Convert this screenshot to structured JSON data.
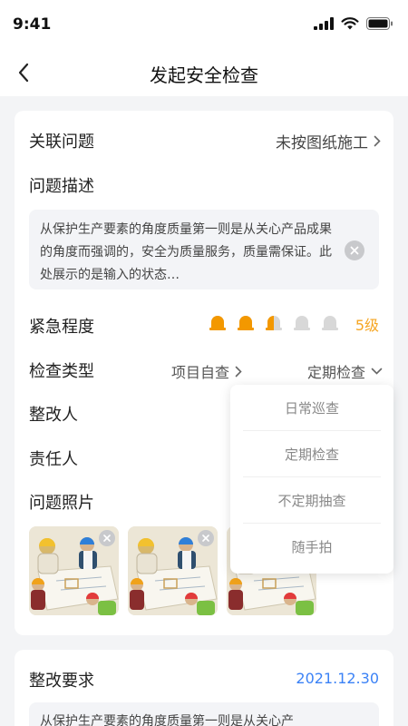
{
  "status": {
    "time": "9:41"
  },
  "nav": {
    "title": "发起安全检查"
  },
  "form": {
    "related_issue": {
      "label": "关联问题",
      "value": "未按图纸施工"
    },
    "issue_desc": {
      "label": "问题描述",
      "text": "从保护生产要素的角度质量第一则是从关心产品成果的角度而强调的，安全为质量服务，质量需保证。此处展示的是输入的状态…"
    },
    "urgency": {
      "label": "紧急程度",
      "level_text": "5级",
      "level": 2.5,
      "max": 5,
      "active_color": "#f39800",
      "inactive_color": "#d8d8d8"
    },
    "check_type": {
      "label": "检查类型",
      "category_value": "项目自查",
      "period_value": "定期检查"
    },
    "rectifier": {
      "label": "整改人"
    },
    "responsible": {
      "label": "责任人"
    },
    "photos": {
      "label": "问题照片",
      "count": 3
    }
  },
  "dropdown": {
    "options": [
      "日常巡查",
      "定期检查",
      "不定期抽查",
      "随手拍"
    ]
  },
  "requirement": {
    "label": "整改要求",
    "date": "2021.12.30",
    "text": "从保护生产要素的角度质量第一则是从关心产"
  },
  "colors": {
    "accent_blue": "#3b82f6",
    "warning_orange": "#f6a623"
  }
}
